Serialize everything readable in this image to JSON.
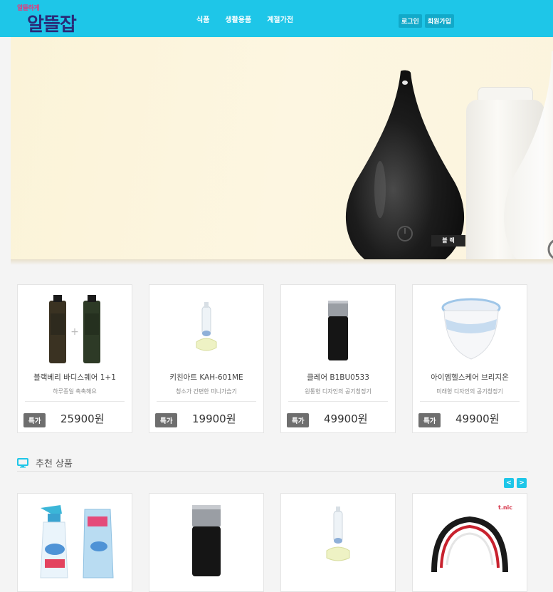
{
  "header": {
    "logo_small": "알뜰하게",
    "logo_main": "알뜰잡",
    "nav": [
      "식품",
      "생활용품",
      "계절가전"
    ],
    "auth": {
      "login": "로그인",
      "signup": "회원가입"
    }
  },
  "banner": {
    "color_label": "블 랙"
  },
  "products": [
    {
      "name": "블랙베리 바디스퀘어 1+1",
      "desc": "하루종일 촉촉해요",
      "badge": "특가",
      "price": "25900원"
    },
    {
      "name": "키친아트 KAH-601ME",
      "desc": "청소가 간편한 미니가습기",
      "badge": "특가",
      "price": "19900원"
    },
    {
      "name": "클레어 B1BU0533",
      "desc": "원통형 디자인의 공기청정기",
      "badge": "특가",
      "price": "49900원"
    },
    {
      "name": "아이엠헬스케어 브리지온",
      "desc": "미래형 디자인의 공기청정기",
      "badge": "특가",
      "price": "49900원"
    }
  ],
  "recommended": {
    "title": "추천 상품",
    "prev": "<",
    "next": ">",
    "brand_text": "t.nic"
  },
  "colors": {
    "header": "#1ec6e8",
    "accent": "#1ec6e8",
    "badge": "#6e6e6e"
  }
}
